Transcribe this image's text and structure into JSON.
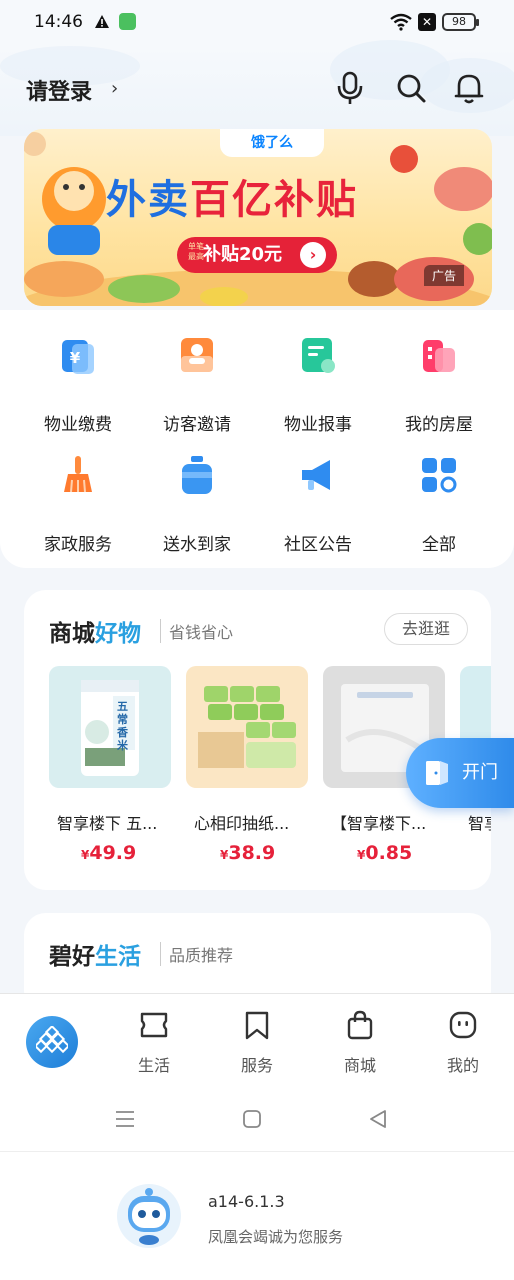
{
  "status_bar": {
    "time": "14:46",
    "battery": "98"
  },
  "header": {
    "login_label": "请登录"
  },
  "banner": {
    "brand": "饿了么",
    "title_part1": "外卖",
    "title_part2": "百亿补贴",
    "pill_small": "单笔 最高",
    "pill_text": "补贴20元",
    "ad_tag": "广告"
  },
  "services": [
    {
      "label": "物业缴费",
      "icon": "property-fee-icon"
    },
    {
      "label": "访客邀请",
      "icon": "visitor-invite-icon"
    },
    {
      "label": "物业报事",
      "icon": "property-report-icon"
    },
    {
      "label": "我的房屋",
      "icon": "my-house-icon"
    },
    {
      "label": "家政服务",
      "icon": "housekeeping-icon"
    },
    {
      "label": "送水到家",
      "icon": "water-delivery-icon"
    },
    {
      "label": "社区公告",
      "icon": "announcement-icon"
    },
    {
      "label": "全部",
      "icon": "all-services-icon"
    }
  ],
  "mall": {
    "title_main": "商城",
    "title_accent": "好物",
    "subtitle": "省钱省心",
    "go_label": "去逛逛",
    "products": [
      {
        "name": "智享楼下 五...",
        "currency": "¥",
        "price": "49.9"
      },
      {
        "name": "心相印抽纸...",
        "currency": "¥",
        "price": "38.9"
      },
      {
        "name": "【智享楼下...",
        "currency": "¥",
        "price": "0.85"
      },
      {
        "name": "智享"
      }
    ],
    "product_labels": {
      "rice_label": "五常香米"
    }
  },
  "open_door": {
    "label": "开门"
  },
  "life": {
    "title_main": "碧好",
    "title_accent": "生活",
    "subtitle": "品质推荐"
  },
  "tabbar": [
    {
      "label": "生活",
      "icon": "life-icon"
    },
    {
      "label": "服务",
      "icon": "service-icon"
    },
    {
      "label": "商城",
      "icon": "mall-icon"
    },
    {
      "label": "我的",
      "icon": "profile-icon"
    }
  ],
  "footer": {
    "version": "a14-6.1.3",
    "slogan": "凤凰会竭诚为您服务"
  },
  "colors": {
    "accent_blue": "#2aa0e0",
    "price_red": "#e6213a",
    "banner_red": "#e52238"
  }
}
